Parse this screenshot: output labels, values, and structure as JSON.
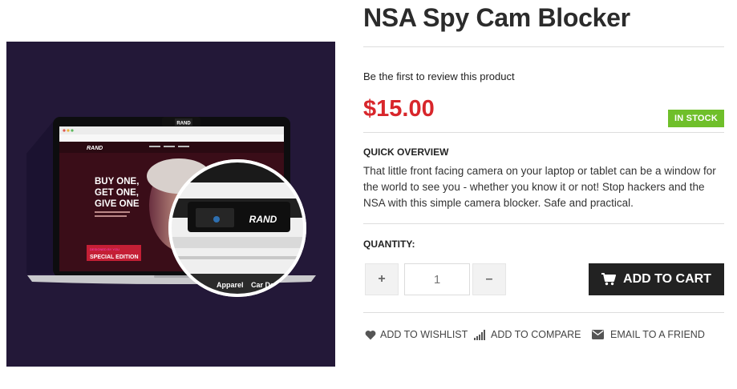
{
  "product": {
    "title": "NSA Spy Cam Blocker",
    "review_link": "Be the first to review this product",
    "price": "$15.00",
    "stock_status": "IN STOCK",
    "overview_heading": "QUICK OVERVIEW",
    "overview_text": "That little front facing camera on your laptop or tablet can be a window for the world to see you - whether you know it or not! Stop hackers and the NSA with this simple camera blocker. Safe and practical."
  },
  "image": {
    "brand": "RAND",
    "headline_lines": [
      "BUY ONE,",
      "GET ONE,",
      "GIVE ONE"
    ],
    "badge_small": "DESIGNED BY YOU",
    "badge_text": "SPECIAL EDITION",
    "nav_labels": [
      "Apparel",
      "Car De"
    ]
  },
  "quantity": {
    "label": "QUANTITY:",
    "value": "1",
    "plus": "+",
    "minus": "–"
  },
  "cart": {
    "label": "ADD TO CART",
    "icon": "shopping-cart-icon"
  },
  "actions": {
    "wishlist": {
      "label": "ADD TO WISHLIST",
      "icon": "heart-icon"
    },
    "compare": {
      "label": "ADD TO COMPARE",
      "icon": "bar-chart-icon"
    },
    "email": {
      "label": "EMAIL TO A FRIEND",
      "icon": "envelope-icon"
    }
  },
  "colors": {
    "price": "#d8262b",
    "stock_badge": "#6fbf2a",
    "cart_button": "#222222",
    "image_background": "#231838"
  }
}
